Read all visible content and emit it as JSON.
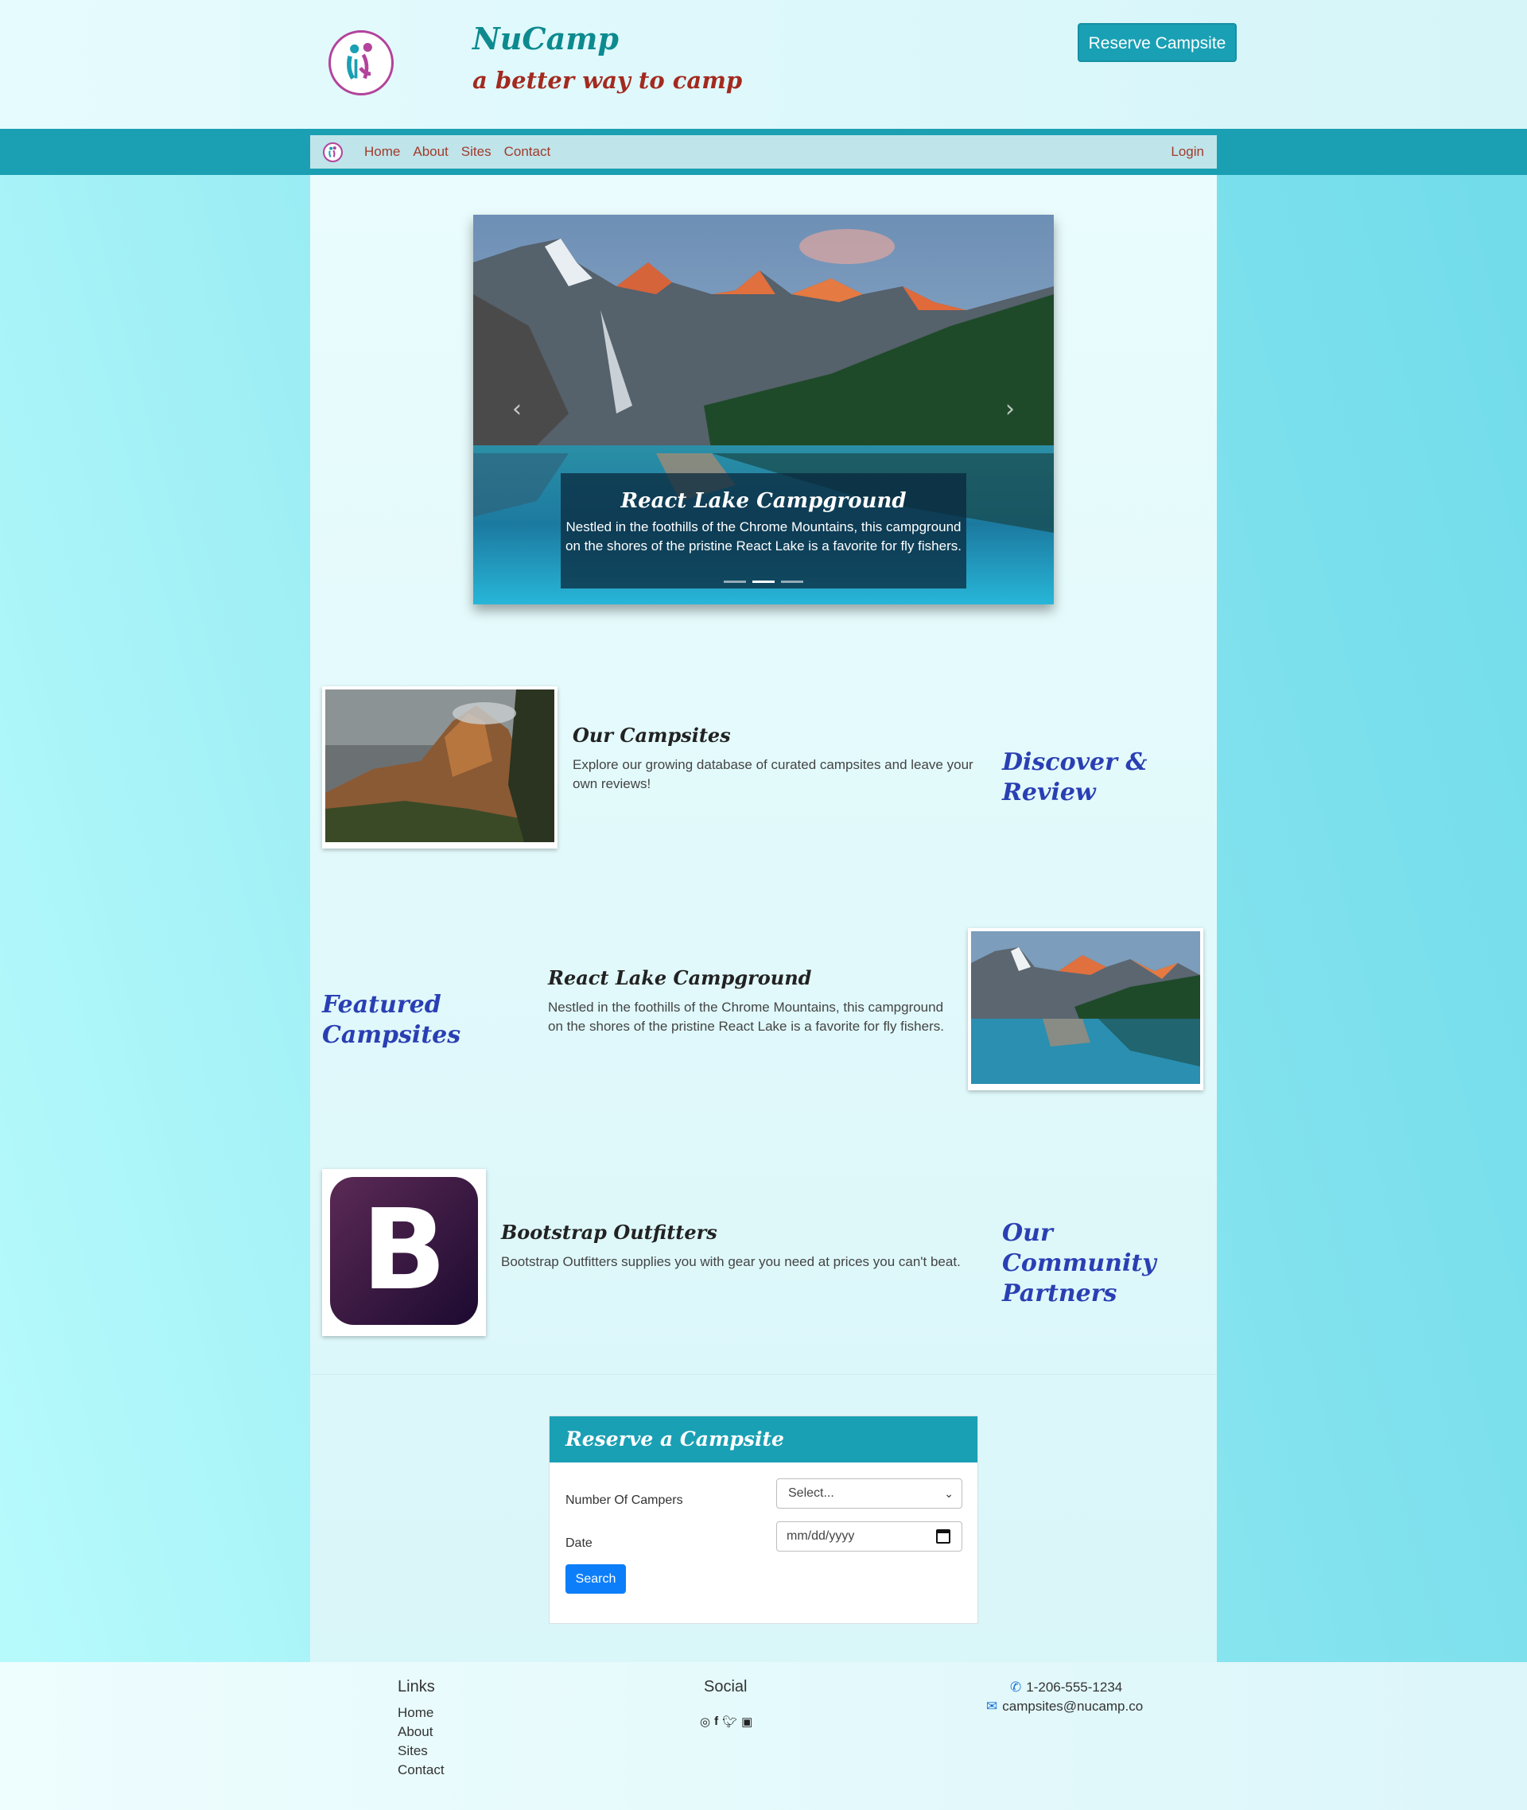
{
  "header": {
    "brand": "NuCamp",
    "tagline": "a better way to camp",
    "reserve_button": "Reserve Campsite"
  },
  "nav": {
    "links": [
      "Home",
      "About",
      "Sites",
      "Contact"
    ],
    "login": "Login"
  },
  "carousel": {
    "caption_title": "React Lake Campground",
    "caption_text": "Nestled in the foothills of the Chrome Mountains, this campground on the shores of the pristine React Lake is a favorite for fly fishers.",
    "slide_count": 3,
    "active_slide": 2
  },
  "sections": [
    {
      "title": "Our Campsites",
      "text": "Explore our growing database of curated campsites and leave your own reviews!",
      "tag": "Discover & Review"
    },
    {
      "title": "React Lake Campground",
      "text": "Nestled in the foothills of the Chrome Mountains, this campground on the shores of the pristine React Lake is a favorite for fly fishers.",
      "tag": "Featured Campsites"
    },
    {
      "title": "Bootstrap Outfitters",
      "text": "Bootstrap Outfitters supplies you with gear you need at prices you can't beat.",
      "tag": "Our Community Partners",
      "logo_letter": "B"
    }
  ],
  "reserve_form": {
    "title": "Reserve a Campsite",
    "campers_label": "Number Of Campers",
    "campers_value": "Select...",
    "date_label": "Date",
    "date_placeholder": "mm/dd/yyyy",
    "search_button": "Search"
  },
  "footer": {
    "links_heading": "Links",
    "links": [
      "Home",
      "About",
      "Sites",
      "Contact"
    ],
    "social_heading": "Social",
    "social_icons": [
      "instagram-icon",
      "facebook-icon",
      "twitter-icon",
      "youtube-icon"
    ],
    "phone": "1-206-555-1234",
    "email": "campsites@nucamp.co"
  },
  "colors": {
    "accent": "#1aa0b4",
    "brand_text": "#0c8a8f",
    "tagline": "#a32a1f",
    "section_tag": "#2a3fb3",
    "search_button": "#0d7ef9"
  }
}
